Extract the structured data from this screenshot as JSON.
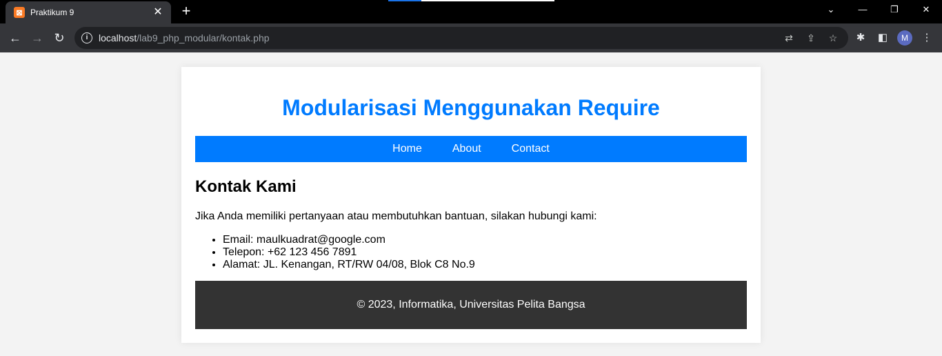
{
  "browser": {
    "tab_title": "Praktikum 9",
    "favicon_label": "⊠",
    "url_host": "localhost",
    "url_path": "/lab9_php_modular/kontak.php",
    "profile_initial": "M"
  },
  "page": {
    "title": "Modularisasi Menggunakan Require",
    "nav": [
      "Home",
      "About",
      "Contact"
    ],
    "heading": "Kontak Kami",
    "intro": "Jika Anda memiliki pertanyaan atau membutuhkan bantuan, silakan hubungi kami:",
    "contacts": [
      "Email: maulkuadrat@google.com",
      "Telepon: +62 123 456 7891",
      "Alamat: JL. Kenangan, RT/RW 04/08, Blok C8 No.9"
    ],
    "footer": "© 2023, Informatika, Universitas Pelita Bangsa"
  },
  "colors": {
    "accent": "#007bff",
    "footer_bg": "#333333",
    "page_bg": "#f3f3f3"
  }
}
